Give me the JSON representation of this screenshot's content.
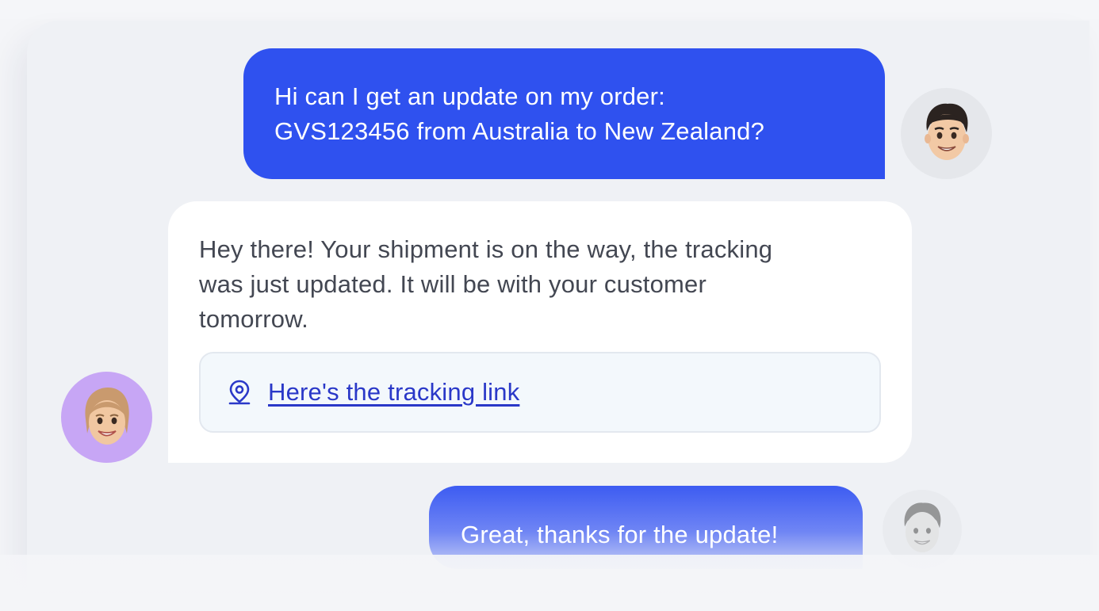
{
  "conversation": {
    "messages": [
      {
        "sender": "customer",
        "lines": [
          "Hi can I get an update on my order:",
          "GVS123456 from Australia to New Zealand?"
        ]
      },
      {
        "sender": "agent",
        "lines": [
          "Hey there! Your shipment is on the way, the tracking",
          "was just updated. It will be with your customer",
          "tomorrow."
        ],
        "link_label": "Here's the tracking link",
        "link_icon": "location-pin-icon"
      },
      {
        "sender": "customer",
        "lines": [
          "Great, thanks for the update!"
        ]
      }
    ]
  },
  "colors": {
    "customer_bubble": "#2f51ef",
    "agent_bubble": "#ffffff",
    "agent_text": "#434752",
    "link": "#2a38c8",
    "agent_avatar_bg": "#c7a6f5",
    "customer_avatar_bg": "#e5e7eb"
  },
  "avatars": {
    "customer": "memoji-man-avatar",
    "agent": "memoji-woman-avatar"
  }
}
